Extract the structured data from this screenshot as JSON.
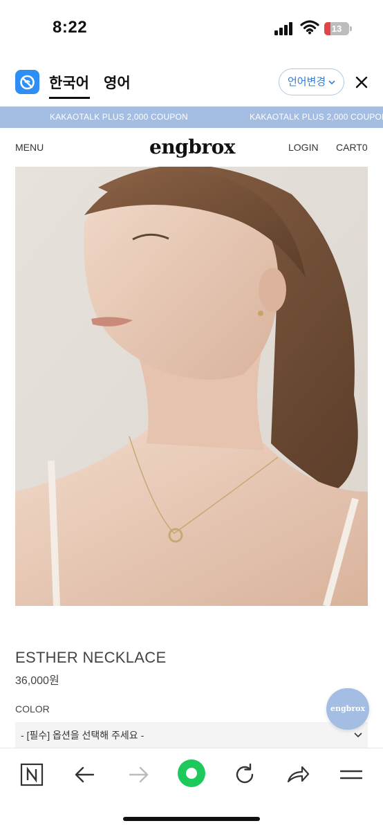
{
  "status_bar": {
    "time": "8:22",
    "battery": "13"
  },
  "translate_bar": {
    "tab_korean": "한국어",
    "tab_english": "영어",
    "change_language": "언어변경"
  },
  "coupon_banner": {
    "text": "KAKAOTALK PLUS 2,000 COUPON"
  },
  "header": {
    "menu": "MENU",
    "brand": "engbrox",
    "login": "LOGIN",
    "cart": "CART0"
  },
  "product": {
    "name": "ESTHER NECKLACE",
    "price": "36,000원",
    "color_label": "COLOR",
    "option_placeholder": "- [필수] 옵션을 선택해 주세요 -"
  },
  "floating_button": {
    "label": "engbrox"
  },
  "colors": {
    "banner": "#a4bde3",
    "toolbar_green": "#1ec95c",
    "lang_blue": "#2f7fd6",
    "logo_blue": "#2f8ef4"
  }
}
